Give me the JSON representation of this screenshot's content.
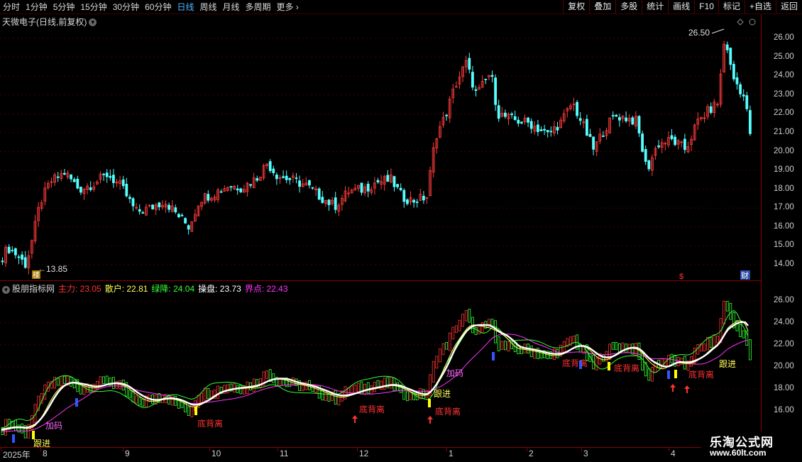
{
  "toolbar": {
    "periods": [
      "分时",
      "1分钟",
      "5分钟",
      "15分钟",
      "30分钟",
      "60分钟",
      "日线",
      "周线",
      "月线",
      "多周期",
      "更多"
    ],
    "tools": [
      "复权",
      "叠加",
      "多股",
      "统计",
      "画线",
      "F10",
      "标记",
      "+自选",
      "返回"
    ]
  },
  "stock_title": "天微电子(日线,前复权)",
  "price_axis": [
    "26.00",
    "25.00",
    "24.00",
    "23.00",
    "22.00",
    "21.00",
    "20.00",
    "19.00",
    "18.00",
    "17.00",
    "16.00",
    "15.00",
    "14.00"
  ],
  "indicator_axis": [
    "26.00",
    "24.00",
    "22.00",
    "20.00",
    "18.00",
    "16.00"
  ],
  "high_label": "26.50",
  "low_label": "13.85",
  "indicator": {
    "name": "股朋指标网",
    "items": [
      {
        "label": "主力: 23.05",
        "color": "#ff3333"
      },
      {
        "label": "散户: 22.81",
        "color": "#ffff55"
      },
      {
        "label": "绿降: 24.04",
        "color": "#33ff33"
      },
      {
        "label": "操盘: 23.73",
        "color": "#ffffff"
      },
      {
        "label": "界点: 22.43",
        "color": "#ff33ff"
      }
    ]
  },
  "signals": {
    "add": "加码",
    "follow": "跟进",
    "bottom": "底背离"
  },
  "markers": {
    "bottom_left": "楼",
    "s": "$",
    "fin": "财"
  },
  "x_axis": [
    "2025年",
    "8",
    "9",
    "10",
    "11",
    "12",
    "1",
    "2",
    "3",
    "4"
  ],
  "watermark": {
    "line1": "乐淘公式网",
    "line2": "www.60lt.com"
  },
  "colors": {
    "up": "#ff3b3b",
    "down": "#54ffff",
    "bg": "#000000",
    "grid": "#8b0000"
  }
}
